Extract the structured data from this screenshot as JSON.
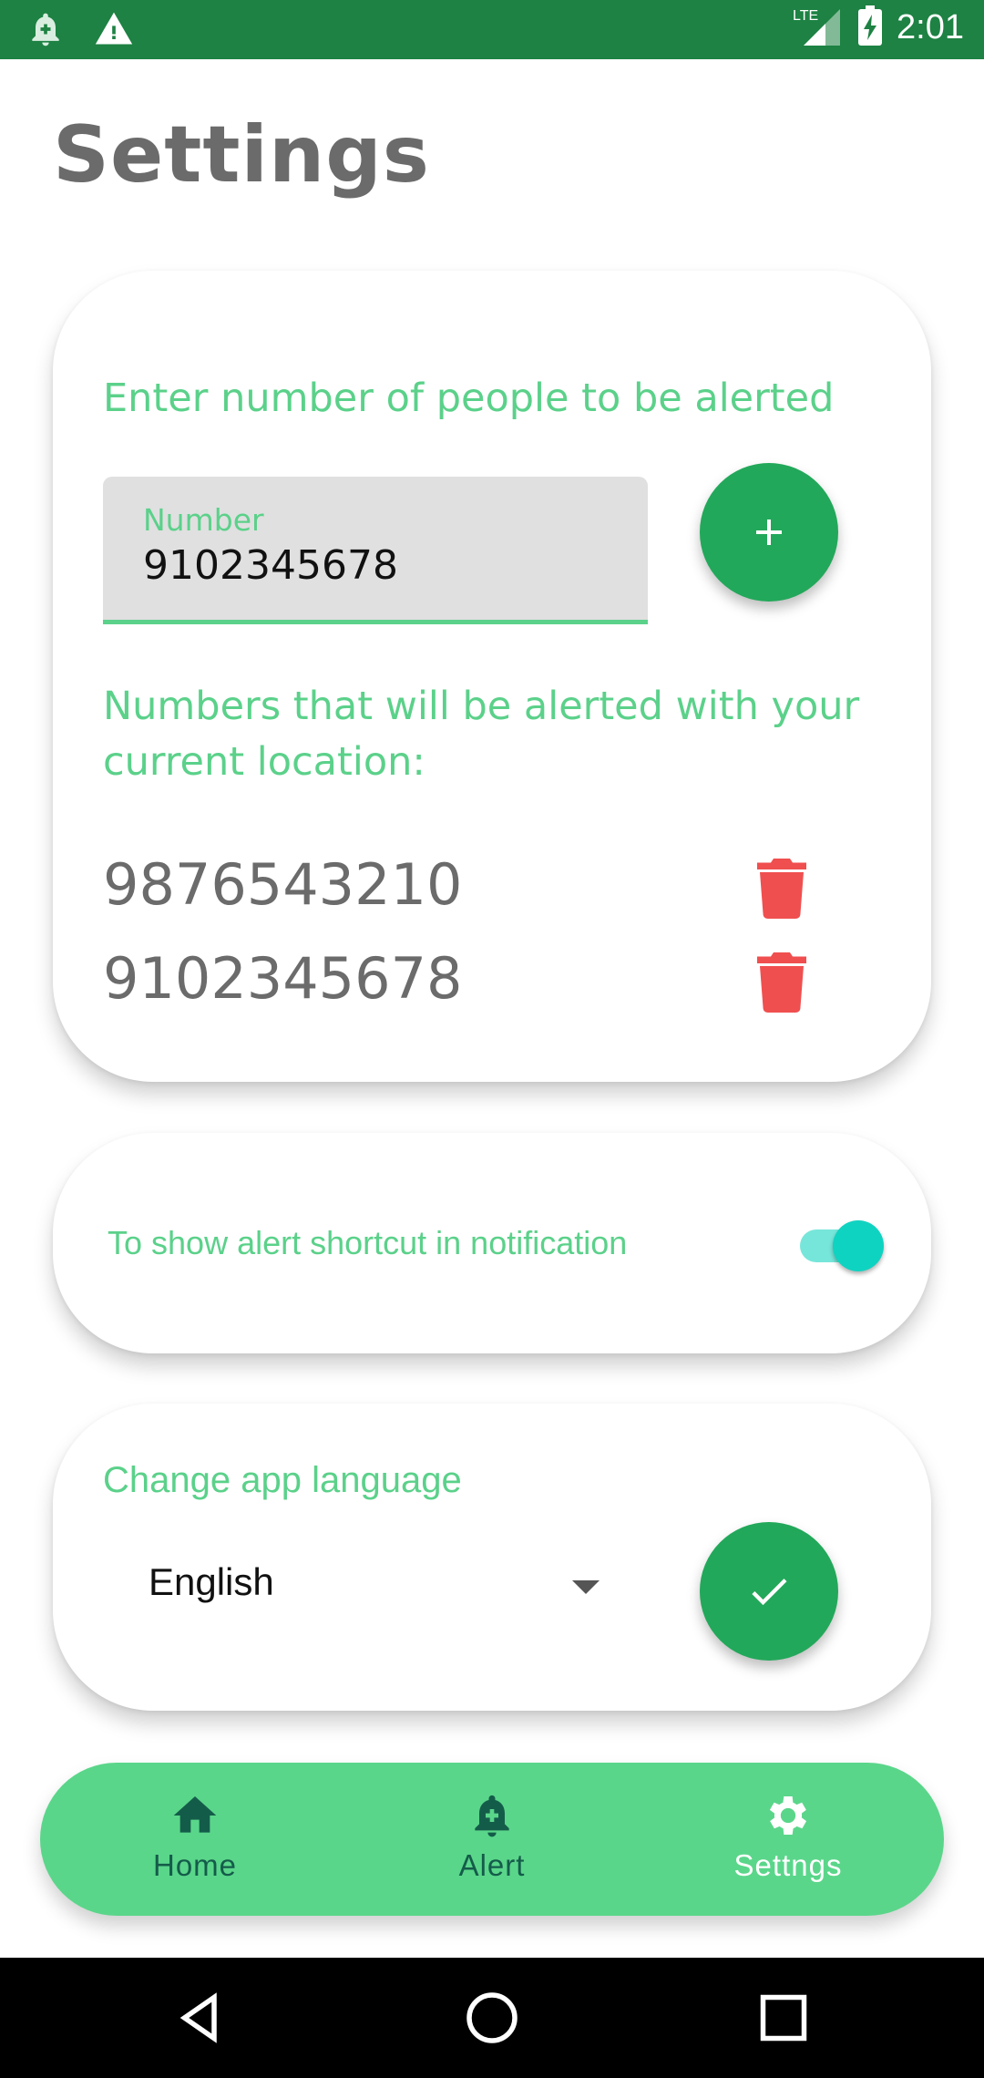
{
  "status_bar": {
    "time": "2:01",
    "network": "LTE",
    "icons": [
      "alert-bell-icon",
      "warning-icon",
      "signal-icon",
      "battery-charging-icon"
    ]
  },
  "page": {
    "title": "Settings"
  },
  "alert_numbers_card": {
    "heading": "Enter number of people to be alerted",
    "input_label": "Number",
    "input_value": "9102345678",
    "add_icon": "plus-icon",
    "list_heading": "Numbers that will be alerted with your current location:",
    "numbers": [
      "9876543210",
      "9102345678"
    ],
    "delete_icon": "trash-icon"
  },
  "notification_card": {
    "label": "To show alert shortcut in notification",
    "toggle_on": true
  },
  "language_card": {
    "heading": "Change app language",
    "selected_language": "English",
    "confirm_icon": "check-icon"
  },
  "bottom_nav": {
    "items": [
      {
        "label": "Home",
        "icon": "home-icon"
      },
      {
        "label": "Alert",
        "icon": "alert-bell-icon"
      },
      {
        "label": "Settngs",
        "icon": "gear-icon"
      }
    ],
    "active_index": 2
  },
  "system_nav": {
    "icons": [
      "back-icon",
      "home-circle-icon",
      "recents-icon"
    ]
  },
  "colors": {
    "status_bar": "#1d8243",
    "accent_green": "#5bd18a",
    "fab_green": "#22a85a",
    "nav_green": "#5ad68a",
    "delete_red": "#f04f4f",
    "toggle_teal": "#0fd3c1"
  }
}
